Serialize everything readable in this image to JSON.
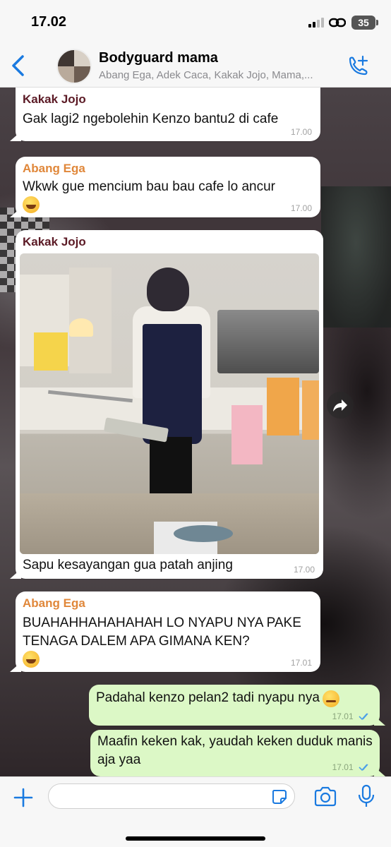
{
  "status": {
    "time": "17.02",
    "battery": "35"
  },
  "header": {
    "title": "Bodyguard mama",
    "members": "Abang Ega, Adek Caca, Kakak Jojo, Mama,..."
  },
  "messages": [
    {
      "sender": "Kakak Jojo",
      "text": "Gak lagi2 ngebolehin Kenzo bantu2 di cafe",
      "time": "17.00"
    },
    {
      "sender": "Abang Ega",
      "text": "Wkwk gue mencium bau bau cafe lo ancur",
      "emoji": "rolling-on-floor-laughing",
      "time": "17.00"
    },
    {
      "sender": "Kakak Jojo",
      "caption": "Sapu kesayangan gua patah anjing",
      "time": "17.00",
      "image": "photo of boy in apron holding broken mop"
    },
    {
      "sender": "Abang Ega",
      "text": "BUAHAHHAHAHAHAH LO NYAPU NYA PAKE TENAGA DALEM APA GIMANA KEN?",
      "emoji": "rolling-on-floor-laughing",
      "time": "17.01"
    },
    {
      "text": "Padahal kenzo pelan2 tadi nyapu nya",
      "emoji": "relieved-face",
      "time": "17.01",
      "outgoing": true
    },
    {
      "text": "Maafin keken kak, yaudah keken duduk manis aja yaa",
      "time": "17.01",
      "outgoing": true
    }
  ],
  "composer": {
    "placeholder": ""
  },
  "colors": {
    "accent": "#1a7ae0",
    "outgoing": "#dcf8c6",
    "jojo": "#5b1a25",
    "ega": "#e0873a"
  }
}
